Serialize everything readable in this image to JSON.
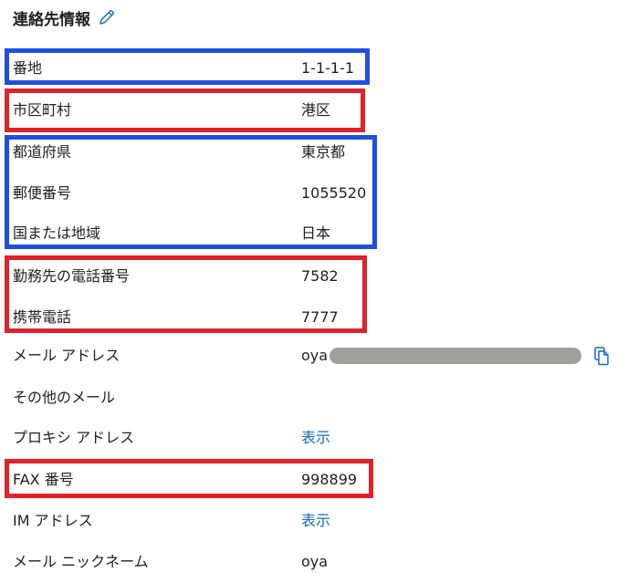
{
  "section": {
    "title": "連絡先情報",
    "edit_icon": "pencil-icon"
  },
  "fields": [
    {
      "label": "番地",
      "value": "1-1-1-1"
    },
    {
      "label": "市区町村",
      "value": "港区"
    },
    {
      "label": "都道府県",
      "value": "東京都"
    },
    {
      "label": "郵便番号",
      "value": "1055520"
    },
    {
      "label": "国または地域",
      "value": "日本"
    },
    {
      "label": "勤務先の電話番号",
      "value": "7582"
    },
    {
      "label": "携帯電話",
      "value": "7777"
    },
    {
      "label": "メール アドレス",
      "value": "oya",
      "value_redacted": true,
      "copy_icon": "copy-icon"
    },
    {
      "label": "その他のメール",
      "value": ""
    },
    {
      "label": "プロキシ アドレス",
      "value": "表示"
    },
    {
      "label": "FAX 番号",
      "value": "998899"
    },
    {
      "label": "IM アドレス",
      "value": "表示"
    },
    {
      "label": "メール ニックネーム",
      "value": "oya"
    }
  ],
  "colors": {
    "highlight_blue": "#1f4fe0",
    "highlight_red": "#e0222a",
    "link": "#0f6cbd",
    "redaction": "#a19f9d"
  }
}
